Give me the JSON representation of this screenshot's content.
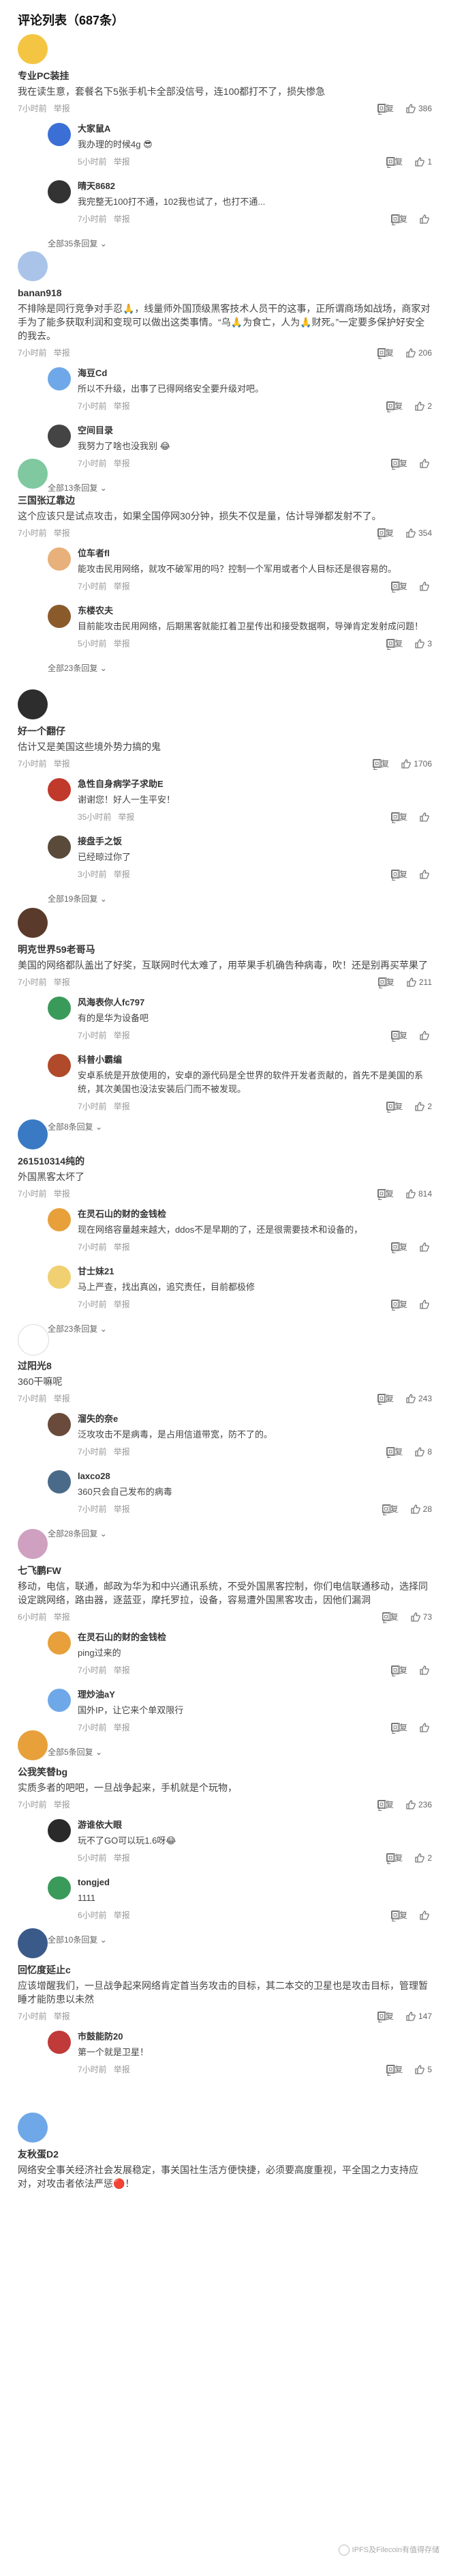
{
  "header": {
    "title": "评论列表（687条）"
  },
  "labels": {
    "reply": "回复",
    "report": "举报"
  },
  "comments": [
    {
      "user": "专业PC装挂",
      "text": "我在读生意，套餐名下5张手机卡全部没信号，连100都打不了，损失惨急",
      "time": "7小时前",
      "likes": "386",
      "avatar_color": "#f4c542",
      "replies": [
        {
          "user": "大家鼠A",
          "text": "我办理的时候4g 😎",
          "time": "5小时前",
          "likes": "1",
          "avatar_color": "#3b6fd6"
        },
        {
          "user": "晴天8682",
          "text": "我完整无100打不通，102我也试了，也打不通...",
          "time": "7小时前",
          "likes": "",
          "avatar_color": "#333333"
        }
      ],
      "expand": "全部35条回复"
    },
    {
      "user": "banan918",
      "text": "不排除是同行竞争对手忍🙏，线量师外国顶级黑客技术人员干的这事，正所谓商场如战场，商家对手为了能多获取利润和变现可以做出这类事情。“乌🙏为食亡，人为🙏财死。”一定要多保护好安全的我去。",
      "time": "7小时前",
      "likes": "206",
      "avatar_color": "#a9c4e8",
      "replies": [
        {
          "user": "海豆Cd",
          "text": "所以不升级，出事了已得网络安全要升级对吧。",
          "time": "7小时前",
          "likes": "2",
          "avatar_color": "#6fa8e8"
        },
        {
          "user": "空间目录",
          "text": "我努力了啥也没我别 😂",
          "time": "7小时前",
          "likes": "",
          "avatar_color": "#444444"
        }
      ],
      "expand": "全部13条回复"
    },
    {
      "user": "三国张辽靠边",
      "text": "这个应该只是试点攻击，如果全国停网30分钟，损失不仅是量，估计导弹都发射不了。",
      "time": "7小时前",
      "likes": "354",
      "avatar_color": "#7fc8a0",
      "replies": [
        {
          "user": "位车者fl",
          "text": "能攻击民用网络，就攻不破军用的吗？控制一个军用或者个人目标还是很容易的。",
          "time": "7小时前",
          "likes": "",
          "avatar_color": "#e8b07a"
        },
        {
          "user": "东楼农夫",
          "text": "目前能攻击民用网络，后期黑客就能扛着卫星传出和接受数据啊，导弹肯定发射成问题！",
          "time": "5小时前",
          "likes": "3",
          "avatar_color": "#8b5a2b"
        }
      ],
      "expand": "全部23条回复"
    },
    {
      "user": "好一个翻仔",
      "text": "估计又是美国这些境外势力搞的鬼",
      "time": "7小时前",
      "likes": "1706",
      "avatar_color": "#2d2d2d",
      "replies": [
        {
          "user": "急性自身病学子求助E",
          "text": "谢谢您！好人一生平安！",
          "time": "35小时前",
          "likes": "",
          "avatar_color": "#c0392b"
        },
        {
          "user": "接盘手之饭",
          "text": "已经晾过你了",
          "time": "3小时前",
          "likes": "",
          "avatar_color": "#5a4a3a"
        }
      ],
      "expand": "全部19条回复"
    },
    {
      "user": "明克世界59老哥马",
      "text": "美国的网络都队盖出了好奖，互联网时代太难了，用苹果手机确告种病毒，吹！还是别再买苹果了",
      "time": "7小时前",
      "likes": "211",
      "avatar_color": "#5a3a2a",
      "replies": [
        {
          "user": "风海表你人fc797",
          "text": "有的是华为设备吧",
          "time": "7小时前",
          "likes": "",
          "avatar_color": "#3a9a5a"
        },
        {
          "user": "科普小霸编",
          "text": "安卓系统是开放使用的，安卓的源代码是全世界的软件开发者贡献的，首先不是美国的系统，其次美国也没法安装后门而不被发现。",
          "time": "7小时前",
          "likes": "2",
          "avatar_color": "#b04a2a"
        }
      ],
      "expand": "全部8条回复"
    },
    {
      "user": "261510314纯的",
      "text": "外国黑客太坏了",
      "time": "7小时前",
      "likes": "814",
      "avatar_color": "#3a7ac4",
      "replies": [
        {
          "user": "在灵石山的财的金钱检",
          "text": "现在网络容量越来越大，ddos不是早期的了，还是很需要技术和设备的，",
          "time": "7小时前",
          "likes": "",
          "avatar_color": "#e8a03a"
        },
        {
          "user": "甘士妹21",
          "text": "马上严查，找出真凶，追究责任，目前都极修",
          "time": "7小时前",
          "likes": "",
          "avatar_color": "#f0d070"
        }
      ],
      "expand": "全部23条回复"
    },
    {
      "user": "过阳光8",
      "text": "360干嘛呢",
      "time": "7小时前",
      "likes": "243",
      "avatar_color": "#ffffff",
      "replies": [
        {
          "user": "溜失的奈e",
          "text": "泛攻攻击不是病毒，是占用信道带宽，防不了的。",
          "time": "7小时前",
          "likes": "8",
          "avatar_color": "#6a4a3a"
        },
        {
          "user": "laxco28",
          "text": "360只会自己发布的病毒",
          "time": "7小时前",
          "likes": "28",
          "avatar_color": "#4a6a8a"
        }
      ],
      "expand": "全部28条回复"
    },
    {
      "user": "七飞鹏FW",
      "text": "移动，电信，联通，邮政为华为和中兴通讯系统，不受外国黑客控制，你们电信联通移动，选择同设定跳网络，路由器，逐蓝亚，摩托罗拉，设备，容易遭外国黑客攻击，因他们漏洞",
      "time": "6小时前",
      "likes": "73",
      "avatar_color": "#d0a0c0",
      "replies": [
        {
          "user": "在灵石山的财的金钱检",
          "text": "ping过来的",
          "time": "7小时前",
          "likes": "",
          "avatar_color": "#e8a03a"
        },
        {
          "user": "理炒油aY",
          "text": "国外IP，让它来个单双限行",
          "time": "7小时前",
          "likes": "",
          "avatar_color": "#6fa8e8"
        }
      ],
      "expand": "全部5条回复"
    },
    {
      "user": "公我笑替bg",
      "text": "实质多者的吧吧，一旦战争起来，手机就是个玩物，",
      "time": "7小时前",
      "likes": "236",
      "avatar_color": "#e8a03a",
      "replies": [
        {
          "user": "游谁依大眼",
          "text": "玩不了GO可以玩1.6呀😂",
          "time": "5小时前",
          "likes": "2",
          "avatar_color": "#2a2a2a"
        },
        {
          "user": "tongjed",
          "text": "1111",
          "time": "6小时前",
          "likes": "",
          "avatar_color": "#3a9a5a"
        }
      ],
      "expand": "全部10条回复"
    },
    {
      "user": "回忆度延止c",
      "text": "应该增醒我们，一旦战争起来网络肯定首当务攻击的目标，其二本交的卫星也是攻击目标，管理暂睡才能防患以未然",
      "time": "7小时前",
      "likes": "147",
      "avatar_color": "#3a5a8a",
      "replies": [
        {
          "user": "市鼓能防20",
          "text": "第一个就是卫星！",
          "time": "7小时前",
          "likes": "5",
          "avatar_color": "#c03a3a"
        }
      ],
      "expand": ""
    },
    {
      "user": "友秋蛋D2",
      "text": "网络安全事关经济社会发展稳定，事关国社生活方便快捷，必须要高度重视，平全国之力支持应对，对攻击者依法严惩🔴！",
      "time": "",
      "likes": "",
      "avatar_color": "#6fa8e8",
      "replies": [],
      "expand": ""
    }
  ],
  "watermark": "IPFS及Filecoin有值得存储"
}
